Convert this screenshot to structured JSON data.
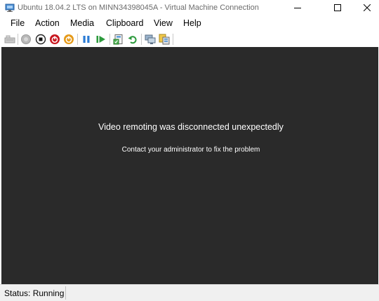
{
  "window": {
    "title": "Ubuntu 18.04.2 LTS on MINN34398045A - Virtual Machine Connection",
    "icon": "vm-connection-icon",
    "controls": [
      "minimize-icon",
      "maximize-icon",
      "close-icon"
    ]
  },
  "menu": {
    "file": "File",
    "action": "Action",
    "media": "Media",
    "clipboard": "Clipboard",
    "view": "View",
    "help": "Help"
  },
  "toolbar": {
    "icons": [
      "ctrl-alt-del-icon",
      "start-icon",
      "turn-off-icon",
      "shut-down-icon",
      "save-state-icon",
      "pause-icon",
      "resume-icon",
      "checkpoint-icon",
      "revert-icon",
      "enhanced-session-icon",
      "share-icon"
    ]
  },
  "screen": {
    "message": "Video remoting was disconnected unexpectedly",
    "submessage": "Contact your administrator to fix the problem",
    "background": "#2a2a2a"
  },
  "status": {
    "text": "Status: Running"
  }
}
